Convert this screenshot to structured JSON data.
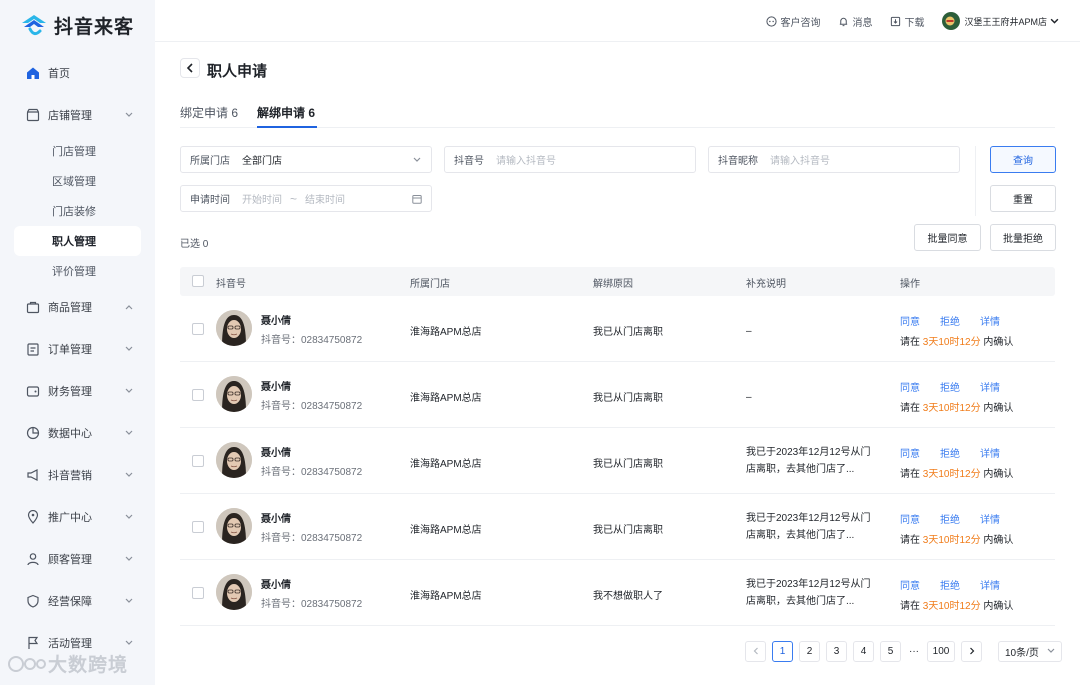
{
  "brand": {
    "name": "抖音来客"
  },
  "sidebar": {
    "home": "首页",
    "store_mgmt": "店铺管理",
    "sub": [
      "门店管理",
      "区域管理",
      "门店装修",
      "职人管理",
      "评价管理"
    ],
    "items": [
      "商品管理",
      "订单管理",
      "财务管理",
      "数据中心",
      "抖音营销",
      "推广中心",
      "顾客管理",
      "经营保障",
      "活动管理"
    ]
  },
  "watermark": "大数跨境",
  "topbar": {
    "service": "客户咨询",
    "messages": "消息",
    "download": "下载",
    "store": "汉堡王王府井APM店"
  },
  "page": {
    "title": "职人申请",
    "tabs": [
      "绑定申请 6",
      "解绑申请 6"
    ]
  },
  "filters": {
    "store_label": "所属门店",
    "store_value": "全部门店",
    "douyin_label": "抖音号",
    "douyin_placeholder": "请输入抖音号",
    "nick_label": "抖音昵称",
    "nick_placeholder": "请输入抖音号",
    "time_label": "申请时间",
    "time_start": "开始时间",
    "time_sep": "~",
    "time_end": "结束时间",
    "query": "查询",
    "reset": "重置",
    "batch_agree": "批量同意",
    "batch_reject": "批量拒绝"
  },
  "selected": "已选 0",
  "table": {
    "headers": [
      "抖音号",
      "所属门店",
      "解绑原因",
      "补充说明",
      "操作"
    ],
    "op_agree": "同意",
    "op_reject": "拒绝",
    "op_detail": "详情",
    "op_prefix": "请在",
    "op_suffix": "内确认",
    "rows": [
      {
        "name": "聂小倩",
        "id": "抖音号：02834750872",
        "store": "淮海路APM总店",
        "reason": "我已从门店离职",
        "note": "–",
        "deadline": "3天10时12分"
      },
      {
        "name": "聂小倩",
        "id": "抖音号：02834750872",
        "store": "淮海路APM总店",
        "reason": "我已从门店离职",
        "note": "–",
        "deadline": "3天10时12分"
      },
      {
        "name": "聂小倩",
        "id": "抖音号：02834750872",
        "store": "淮海路APM总店",
        "reason": "我已从门店离职",
        "note": "我已于2023年12月12号从门店离职，去其他门店了...",
        "deadline": "3天10时12分"
      },
      {
        "name": "聂小倩",
        "id": "抖音号：02834750872",
        "store": "淮海路APM总店",
        "reason": "我已从门店离职",
        "note": "我已于2023年12月12号从门店离职，去其他门店了...",
        "deadline": "3天10时12分"
      },
      {
        "name": "聂小倩",
        "id": "抖音号：02834750872",
        "store": "淮海路APM总店",
        "reason": "我不想做职人了",
        "note": "我已于2023年12月12号从门店离职，去其他门店了...",
        "deadline": "3天10时12分"
      }
    ]
  },
  "pagination": {
    "pages": [
      "1",
      "2",
      "3",
      "4",
      "5"
    ],
    "ellipsis": "···",
    "last": "100",
    "page_size": "10条/页"
  },
  "colors": {
    "accent": "#3a7cf0",
    "deadline": "#f07c1a",
    "active_nav": "#ffffff"
  }
}
